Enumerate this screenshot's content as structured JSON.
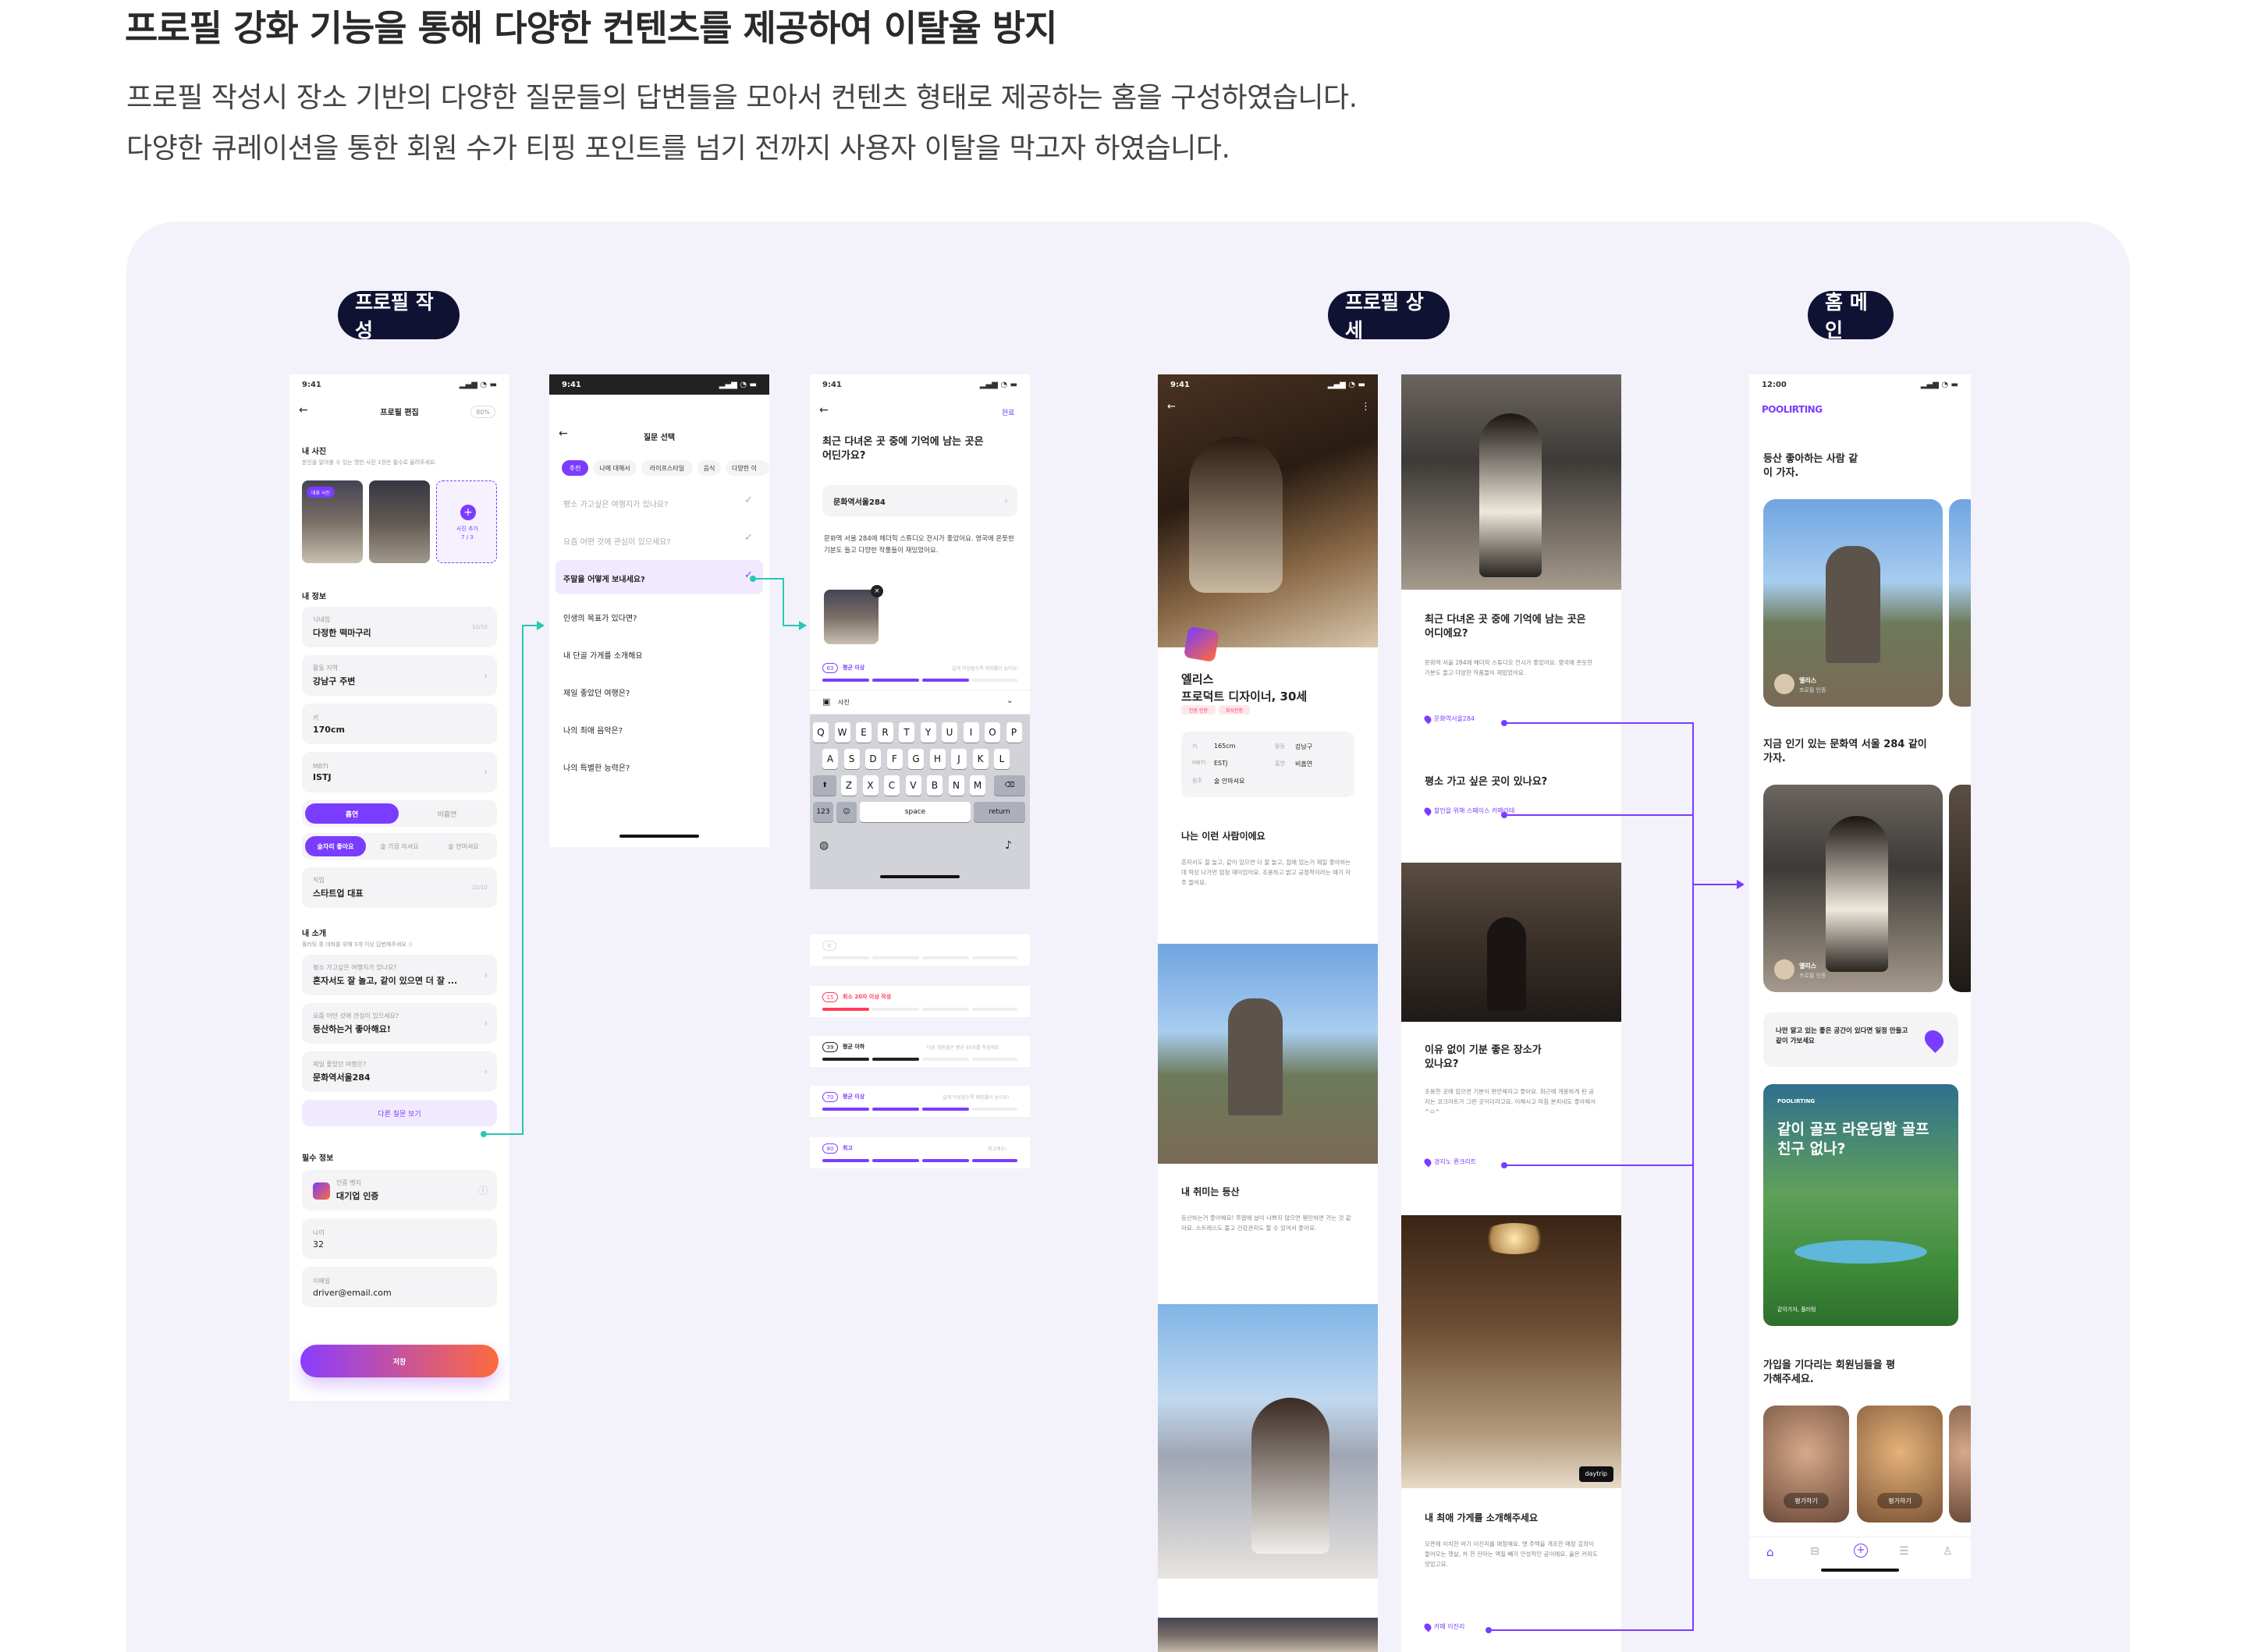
{
  "header": {
    "title": "프로필 강화 기능을 통해 다양한 컨텐츠를 제공하여 이탈율 방지",
    "sub1": "프로필 작성시 장소 기반의 다양한 질문들의 답변들을 모아서 컨텐츠 형태로 제공하는 홈을 구성하였습니다.",
    "sub2": "다양한 큐레이션을 통한 회원 수가 티핑 포인트를 넘기 전까지 사용자 이탈을 막고자 하였습니다."
  },
  "labels": {
    "write": "프로필 작성",
    "detail": "프로필 상세",
    "home": "홈 메인"
  },
  "colors": {
    "accent": "#7a3cff",
    "navy": "#0f1233",
    "teal": "#2bc6b4",
    "board": "#f3f2fb"
  },
  "p1": {
    "time": "9:41",
    "title": "프로필 편집",
    "pct": "80%",
    "photos_h": "내 사진",
    "photos_d": "본인을 알아볼 수 있는 명한 사진 1장은 필수로 올려주세요.",
    "badge": "대표 사진",
    "add_photo": "사진 추가",
    "add_count": "7 / 3",
    "info_h": "내 정보",
    "nick_l": "닉네임",
    "nick_v": "다정한 떡마구리",
    "nick_c": "10/10",
    "area_l": "활동 지역",
    "area_v": "강남구 주변",
    "height_l": "키",
    "height_v": "170cm",
    "mbti_l": "MBTI",
    "mbti_v": "ISTJ",
    "smoke_on": "흡연",
    "smoke_off": "비흡연",
    "drink1": "술자리 좋아요",
    "drink2": "술 가끔 마셔요",
    "drink3": "술 안마셔요",
    "job_l": "직업",
    "job_v": "스타트업 대표",
    "job_c": "10/10",
    "intro_h": "내 소개",
    "intro_d": "플러팅 중 대화를 위해 3개 이상 답변해주세요 :)",
    "qa1_l": "평소 가고싶은 여행지가 있나요?",
    "qa1_v": "혼자서도 잘 놀고, 같이 있으면 더 잘 ...",
    "qa2_l": "요즘 어떤 것에 관심이 있으세요?",
    "qa2_v": "등산하는거 좋아해요!",
    "qa3_l": "제일 좋았던 여행은?",
    "qa3_v": "문화역서울284",
    "more": "다른 질문 보기",
    "req_h": "필수 정보",
    "cert_l": "인증 뱃지",
    "cert_v": "대기업 인증",
    "age_l": "나이",
    "age_v": "32",
    "email_l": "이메일",
    "email_v": "driver@email.com",
    "save": "저장"
  },
  "p2": {
    "time": "9:41",
    "title": "질문 선택",
    "tabs": [
      "추천",
      "나에 대해서",
      "라이프스타일",
      "음식",
      "다양한 이"
    ],
    "q1": "평소 가고싶은 여행지가 있나요?",
    "q2": "요즘 어떤 것에 관심이 있으세요?",
    "q3": "주말을 어떻게 보내세요?",
    "q4": "인생의 목표가 있다면?",
    "q5": "내 단골 가게를 소개해요",
    "q6": "제일 좋았던 여행은?",
    "q7": "나의 최애 음악은?",
    "q8": "나의 특별한 능력은?"
  },
  "p3": {
    "time": "9:41",
    "done": "완료",
    "question": "최근 다녀온 곳 중에 기억에 남는 곳은 어딘가요?",
    "place": "문화역서울284",
    "answer": "문화역 서울 284에 헤더힉 스튜디오 전시가 좋았어요. 영국에 온듯한 기분도 들고 다양한 작품들이 재밌었어요.",
    "count_tag": "63",
    "count_ok": "평균 이상",
    "count_hint": "길게 작성할수록 매칭률이 높아요!",
    "attach": "사진",
    "keys_r1": [
      "Q",
      "W",
      "E",
      "R",
      "T",
      "Y",
      "U",
      "I",
      "O",
      "P"
    ],
    "keys_r2": [
      "A",
      "S",
      "D",
      "F",
      "G",
      "H",
      "J",
      "K",
      "L"
    ],
    "keys_r3": [
      "Z",
      "X",
      "C",
      "V",
      "B",
      "N",
      "M"
    ],
    "k123": "123",
    "space": "space",
    "return": "return"
  },
  "meters": {
    "m1_tag": "0",
    "m2_tag": "15",
    "m2_t": "최소 20자 이상 작성",
    "m3_tag": "39",
    "m3_t": "평균 이하",
    "m3_h": "다른 회원들은 평균 60자를 작성해요",
    "m4_tag": "70",
    "m4_t": "평균 이상",
    "m4_h": "길게 작성할수록 매칭률이 높아요!",
    "m5_tag": "80",
    "m5_t": "최고",
    "m5_h": "최고예요!"
  },
  "d1": {
    "time": "9:41",
    "name": "엘리스",
    "job": "프로덕트 디자이너, 30세",
    "tag1": "인증 인증",
    "tag2": "회사인증",
    "k_h": "키",
    "v_h": "165cm",
    "k_a": "활동",
    "v_a": "강남구",
    "k_m": "MBTI",
    "v_m": "ESTJ",
    "k_s": "흡연",
    "v_s": "비흡연",
    "k_d": "음주",
    "v_d": "술 안마셔요",
    "intro_h": "나는 이런 사람이에요",
    "intro": "혼자서도 잘 놀고, 같이 있으면 더 잘 놀고, 집에 있는거 제일 좋아하는데 막상 나가면 엄청 재미있어요. 조용하고 밝고 긍정적이라는 얘기 자주 들어요.",
    "hobby_h": "내 취미는 등산",
    "hobby": "등산하는거 좋아해요! 주말에 날이 나쁘지 않으면 웬만하면 가는 것 같아요. 스트레스도 풀고 건강관리도 할 수 있어서 좋아요."
  },
  "d2": {
    "q1": "최근 다녀온 곳 중에 기억에 남는 곳은 어디에요?",
    "a1": "문화역 서울 284에 헤더힉 스튜디오 전시가 좋았어요. 영국에 온듯한 기분도 들고 다양한 작품들이 재밌었어요.",
    "l1": "문화역서울284",
    "q2": "평소 가고 싶은 곳이 있나요?",
    "l2": "할인을 위해 스페이스 카페라테",
    "q3": "이유 없이 기분 좋은 장소가 있나요?",
    "a3": "조용한 곳에 있으면 기분이 편안해지고 좋아요. 최근에 개봉하게 된 공자는 코크라트가 그런 곳이더라고요. 이해시고 마침 분치네도 좋아해서 ^ㅁ^",
    "l3": "경지노 퀸크리트",
    "q4": "내 최애 가게를 소개해주세요",
    "a4": "오픈에 이치한 여기 이진리를 애정해요. 옛 주택을 개조한 매장 감좌이 들어오는 햇살, 차 한 잔마는 맥질 빼가 안성적인 공이에요. 옳은 커피도 맛있고요.",
    "l4": "카페 이진리",
    "watermark": "daytrip"
  },
  "home": {
    "time": "12:00",
    "logo": "POOLIRTING",
    "s1": "등산 좋아하는 사람 같이 가자.",
    "card_name": "엘리스",
    "card_sub": "프로필 인증",
    "s2": "지금 인기 있는 문화역 서울 284 같이 가자.",
    "banner": "나만 알고 있는 좋은 공간이 있다면 일정 만들고 같이 가보세요",
    "golf_brand": "POOLIRTING",
    "golf": "같이 골프 라운딩할 골프친구 없나?",
    "golf_tag": "같이가자, 플러팅",
    "s3": "가입을 기다리는 회원님들을 평가해주세요.",
    "rate": "평가하기"
  }
}
